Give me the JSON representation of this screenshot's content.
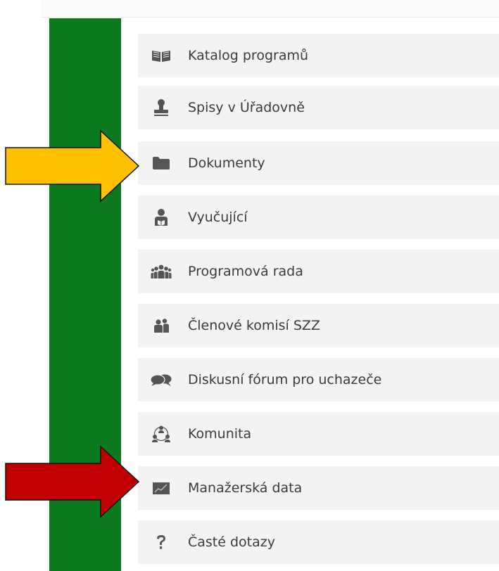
{
  "menu": {
    "items": [
      {
        "label": "Katalog programů",
        "icon": "book-icon"
      },
      {
        "label": "Spisy v Úřadovně",
        "icon": "stamp-icon"
      },
      {
        "label": "Dokumenty",
        "icon": "folder-icon"
      },
      {
        "label": "Vyučující",
        "icon": "teacher-icon"
      },
      {
        "label": "Programová rada",
        "icon": "group-icon"
      },
      {
        "label": "Členové komisí SZZ",
        "icon": "users-icon"
      },
      {
        "label": "Diskusní fórum pro uchazeče",
        "icon": "chat-icon"
      },
      {
        "label": "Komunita",
        "icon": "community-icon"
      },
      {
        "label": "Manažerská data",
        "icon": "chart-icon"
      },
      {
        "label": "Časté dotazy",
        "icon": "question-icon"
      }
    ]
  },
  "colors": {
    "sidebar_green": "#0b7a1e",
    "menu_background": "#f3f3f3",
    "icon_gray": "#555555",
    "label_text": "#3b3b3b",
    "arrow_yellow": "#ffc000",
    "arrow_red": "#c00000"
  },
  "annotations": [
    {
      "name": "yellow-arrow",
      "points_to": "Dokumenty"
    },
    {
      "name": "red-arrow",
      "points_to": "Manažerská data"
    }
  ]
}
